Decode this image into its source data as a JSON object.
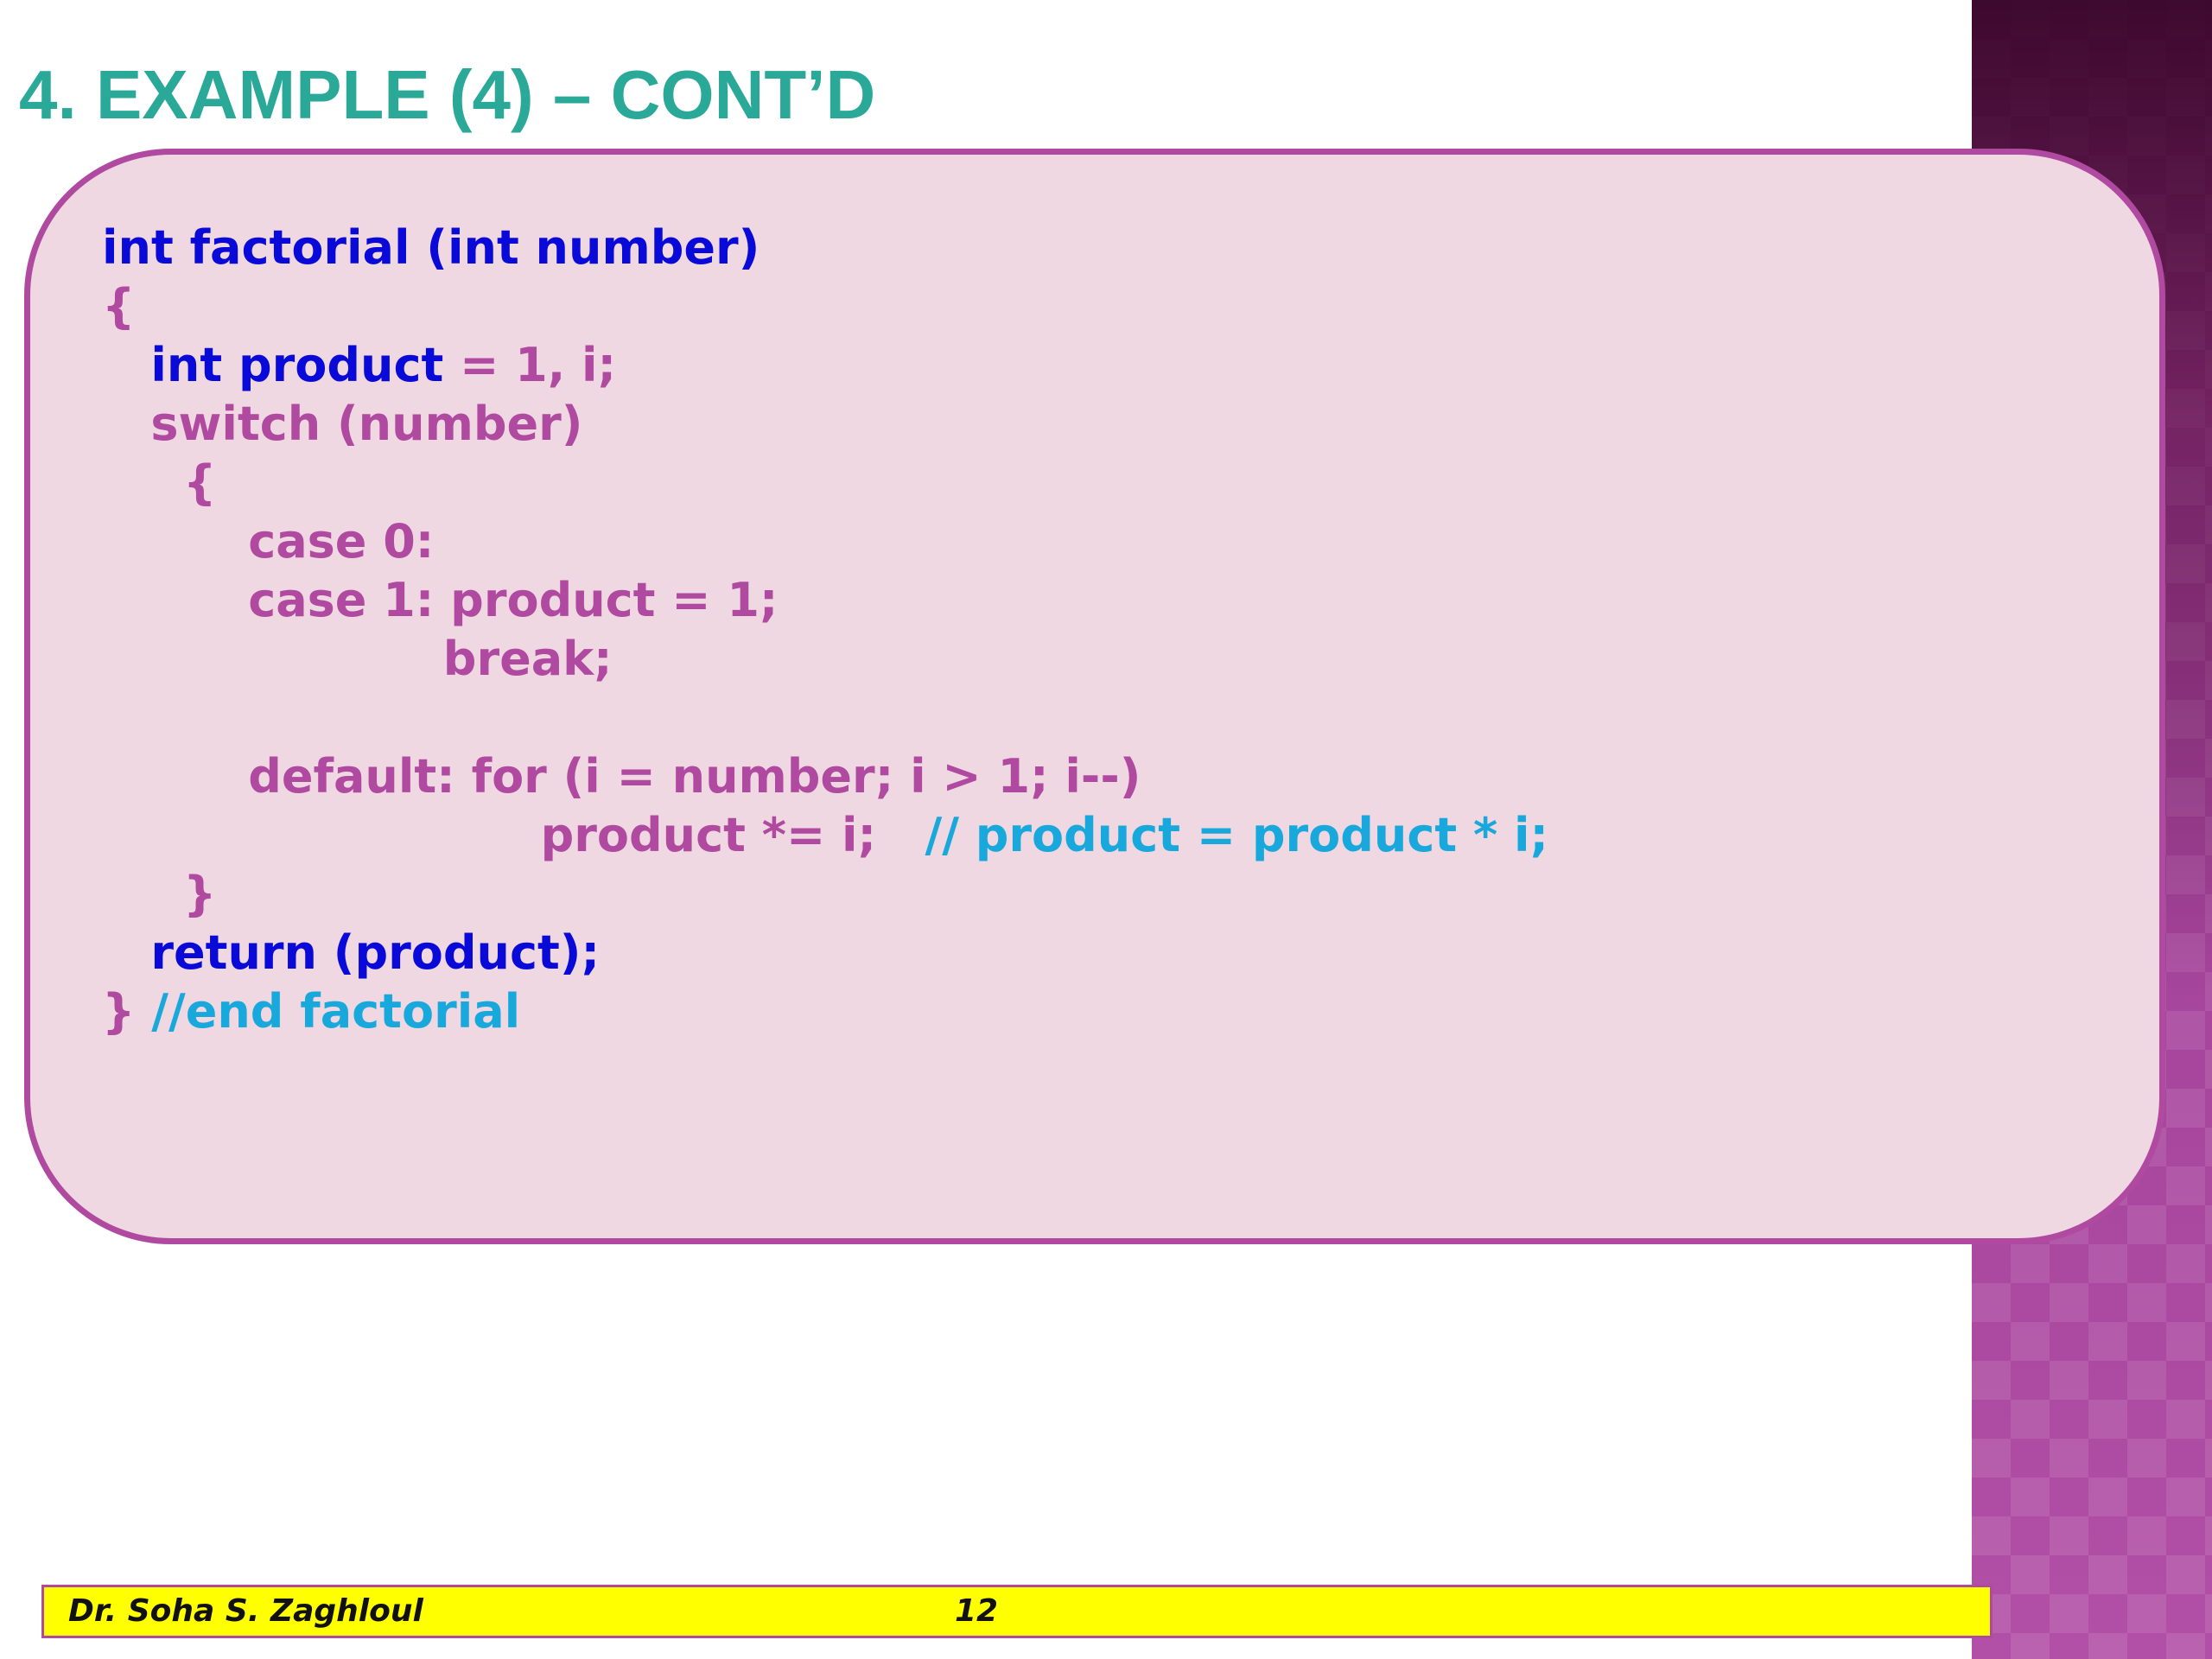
{
  "slide": {
    "title": "4. EXAMPLE (4) – CONT’D",
    "title_color": "#2aa898",
    "panel_color": "#f0d8e2",
    "panel_border_color": "#b04aa0",
    "side_band_color": "#8a3380"
  },
  "code": {
    "colors": {
      "keyword": "#0a0ad8",
      "default": "#b04aa0",
      "comment": "#18a8dc"
    },
    "lines": [
      [
        {
          "t": "int factorial (int number)",
          "c": "kw"
        }
      ],
      [
        {
          "t": "{",
          "c": "op"
        }
      ],
      [
        {
          "t": "   int product ",
          "c": "kw"
        },
        {
          "t": "= 1, i;",
          "c": "op"
        }
      ],
      [
        {
          "t": "   switch (number)",
          "c": "op"
        }
      ],
      [
        {
          "t": "     {",
          "c": "op"
        }
      ],
      [
        {
          "t": "         case 0:",
          "c": "op"
        }
      ],
      [
        {
          "t": "         case 1: product = 1;",
          "c": "op"
        }
      ],
      [
        {
          "t": "                     break;",
          "c": "op"
        }
      ],
      [
        {
          "t": "",
          "c": "op"
        }
      ],
      [
        {
          "t": "         default: for (i = number; i > 1; i--)",
          "c": "op"
        }
      ],
      [
        {
          "t": "                           product *= i;   ",
          "c": "op"
        },
        {
          "t": "// product = product * i;",
          "c": "cm"
        }
      ],
      [
        {
          "t": "     }",
          "c": "op"
        }
      ],
      [
        {
          "t": "   return (product);",
          "c": "kw"
        }
      ],
      [
        {
          "t": "} ",
          "c": "op"
        },
        {
          "t": "//end factorial",
          "c": "cm"
        }
      ]
    ]
  },
  "footer": {
    "author": "Dr. Soha S. Zaghloul",
    "page": "12",
    "bar_color": "#ffff00"
  }
}
